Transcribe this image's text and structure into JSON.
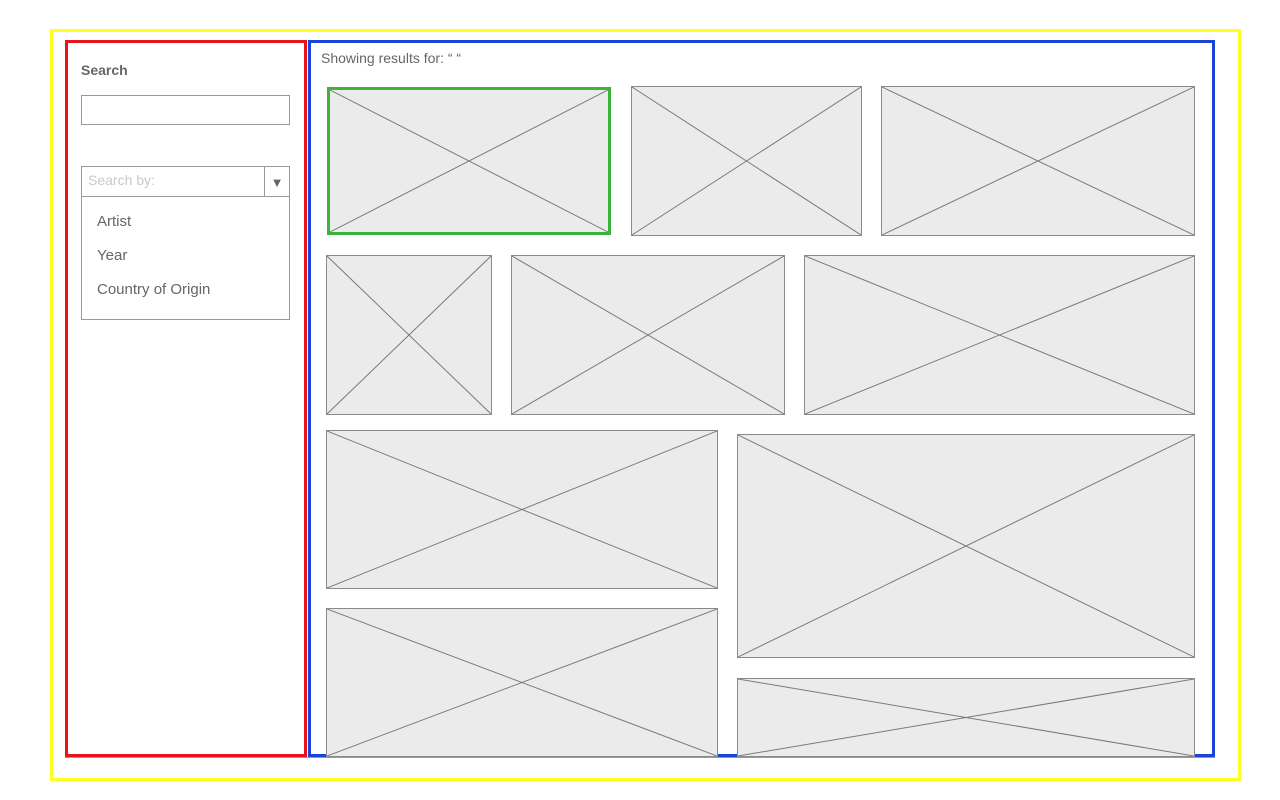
{
  "sidebar": {
    "heading": "Search",
    "search_value": "",
    "search_by": {
      "placeholder": "Search by:",
      "arrow_icon": "▼",
      "options": [
        "Artist",
        "Year",
        "Country of Origin"
      ]
    }
  },
  "results": {
    "label": "Showing results for: “ “",
    "thumbnails": [
      {
        "name": "image-placeholder",
        "selected": true
      },
      {
        "name": "image-placeholder",
        "selected": false
      },
      {
        "name": "image-placeholder",
        "selected": false
      },
      {
        "name": "image-placeholder",
        "selected": false
      },
      {
        "name": "image-placeholder",
        "selected": false
      },
      {
        "name": "image-placeholder",
        "selected": false
      },
      {
        "name": "image-placeholder",
        "selected": false
      },
      {
        "name": "image-placeholder",
        "selected": false
      },
      {
        "name": "image-placeholder",
        "selected": false
      },
      {
        "name": "image-placeholder",
        "selected": false
      }
    ]
  },
  "colors": {
    "outer_frame": "#ffff22",
    "sidebar_frame": "#e8141c",
    "results_frame": "#1a44d8",
    "selected_thumb": "#3cb43c",
    "thumb_fill": "#ebebeb"
  }
}
